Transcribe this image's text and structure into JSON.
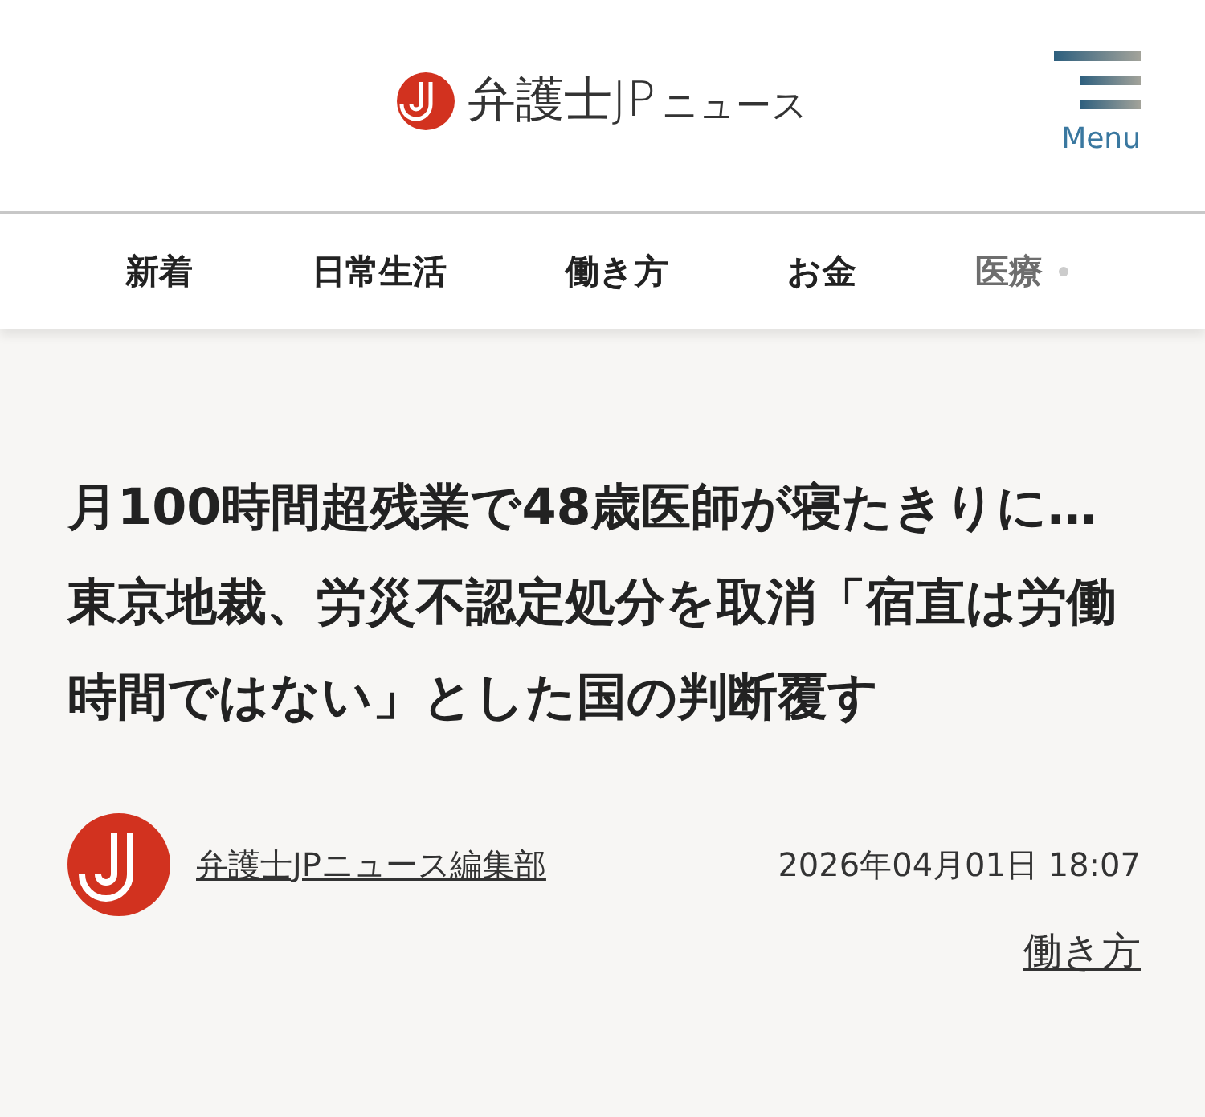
{
  "header": {
    "logo": {
      "name": "弁護士JP",
      "suffix": "ニュース"
    },
    "menu_label": "Menu"
  },
  "nav": [
    {
      "label": "新着",
      "faded": false
    },
    {
      "label": "日常生活",
      "faded": false
    },
    {
      "label": "働き方",
      "faded": false
    },
    {
      "label": "お金",
      "faded": false
    },
    {
      "label": "医療",
      "faded": true
    }
  ],
  "article": {
    "title": "月100時間超残業で48歳医師が寝たきりに…東京地裁、労災不認定処分を取消「宿直は労働時間ではない」とした国の判断覆す",
    "author": "弁護士JPニュース編集部",
    "date": "2026年04月01日 18:07",
    "category": "働き方"
  }
}
